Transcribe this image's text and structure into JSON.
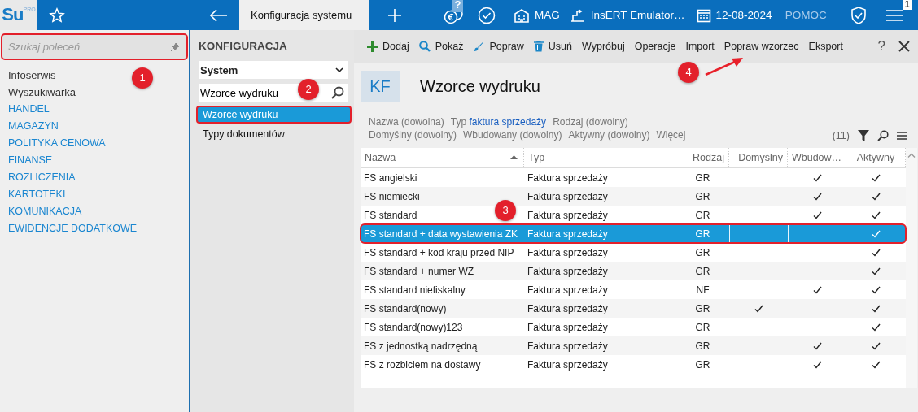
{
  "logo": {
    "text": "Su",
    "edition": "PRO"
  },
  "tabs": [
    {
      "label": "Konfiguracja systemu",
      "selected": true
    }
  ],
  "header_items": [
    {
      "kind": "coins",
      "badge": "?"
    },
    {
      "kind": "check"
    },
    {
      "kind": "building",
      "label": "MAG"
    },
    {
      "kind": "emulator",
      "label": "InsERT Emulator…"
    },
    {
      "kind": "calendar",
      "label": "12-08-2024"
    },
    {
      "kind": "text",
      "label": "POMOC"
    },
    {
      "kind": "shield"
    },
    {
      "kind": "menu",
      "badge": "1"
    }
  ],
  "sidebar": {
    "search": {
      "placeholder": "Szukaj poleceń",
      "highlighted": true
    },
    "items": [
      {
        "label": "Infoserwis",
        "kind": "link"
      },
      {
        "label": "Wyszukiwarka",
        "kind": "link"
      },
      {
        "label": "HANDEL",
        "kind": "module"
      },
      {
        "label": "MAGAZYN",
        "kind": "module"
      },
      {
        "label": "POLITYKA CENOWA",
        "kind": "module"
      },
      {
        "label": "FINANSE",
        "kind": "module"
      },
      {
        "label": "ROZLICZENIA",
        "kind": "module"
      },
      {
        "label": "KARTOTEKI",
        "kind": "module"
      },
      {
        "label": "KOMUNIKACJA",
        "kind": "module"
      },
      {
        "label": "EWIDENCJE DODATKOWE",
        "kind": "module"
      }
    ]
  },
  "config_panel": {
    "title": "KONFIGURACJA",
    "dropdown": "System",
    "search": {
      "value": "Wzorce wydruku"
    },
    "items": [
      {
        "label": "Wzorce wydruku",
        "selected": true,
        "highlighted": true
      },
      {
        "label": "Typy dokumentów",
        "selected": false,
        "highlighted": false
      }
    ]
  },
  "toolbar": {
    "buttons": [
      {
        "kind": "add",
        "label": "Dodaj"
      },
      {
        "kind": "show",
        "label": "Pokaż"
      },
      {
        "kind": "edit",
        "label": "Popraw"
      },
      {
        "kind": "delete",
        "label": "Usuń"
      },
      {
        "kind": "text",
        "label": "Wypróbuj"
      },
      {
        "kind": "text",
        "label": "Operacje"
      },
      {
        "kind": "text",
        "label": "Import"
      },
      {
        "kind": "text",
        "label": "Popraw wzorzec"
      },
      {
        "kind": "text",
        "label": "Eksport"
      }
    ],
    "help": "?"
  },
  "view": {
    "badge": "KF",
    "title": "Wzorce wydruku"
  },
  "filters": [
    [
      {
        "label": "Nazwa (dowolna)"
      },
      {
        "label": "Typ",
        "value": "faktura sprzedaży"
      },
      {
        "label": "Rodzaj (dowolny)"
      }
    ],
    [
      {
        "label": "Domyślny (dowolny)"
      },
      {
        "label": "Wbudowany (dowolny)"
      },
      {
        "label": "Aktywny (dowolny)"
      },
      {
        "label": "Więcej"
      }
    ]
  ],
  "count": "(11)",
  "table": {
    "columns": [
      {
        "label": "Nazwa",
        "sorted_ascending": true
      },
      {
        "label": "Typ",
        "sorted_ascending": false
      },
      {
        "label": "Rodzaj",
        "sorted_ascending": false
      },
      {
        "label": "Domyślny",
        "sorted_ascending": false
      },
      {
        "label": "Wbudow…",
        "sorted_ascending": false
      },
      {
        "label": "Aktywny",
        "sorted_ascending": false
      }
    ],
    "rows": [
      {
        "name": "FS angielski",
        "type": "Faktura sprzedaży",
        "kind": "GR",
        "default": false,
        "builtin": true,
        "active": true,
        "selected": false,
        "highlighted": false
      },
      {
        "name": "FS niemiecki",
        "type": "Faktura sprzedaży",
        "kind": "GR",
        "default": false,
        "builtin": true,
        "active": true,
        "selected": false,
        "highlighted": false
      },
      {
        "name": "FS standard",
        "type": "Faktura sprzedaży",
        "kind": "GR",
        "default": false,
        "builtin": true,
        "active": true,
        "selected": false,
        "highlighted": false
      },
      {
        "name": "FS standard + data wystawienia ZK",
        "type": "Faktura sprzedaży",
        "kind": "GR",
        "default": false,
        "builtin": false,
        "active": true,
        "selected": true,
        "highlighted": true
      },
      {
        "name": "FS standard + kod kraju przed NIP",
        "type": "Faktura sprzedaży",
        "kind": "GR",
        "default": false,
        "builtin": false,
        "active": true,
        "selected": false,
        "highlighted": false
      },
      {
        "name": "FS standard + numer WZ",
        "type": "Faktura sprzedaży",
        "kind": "GR",
        "default": false,
        "builtin": false,
        "active": true,
        "selected": false,
        "highlighted": false
      },
      {
        "name": "FS standard niefiskalny",
        "type": "Faktura sprzedaży",
        "kind": "NF",
        "default": false,
        "builtin": true,
        "active": true,
        "selected": false,
        "highlighted": false
      },
      {
        "name": "FS standard(nowy)",
        "type": "Faktura sprzedaży",
        "kind": "GR",
        "default": true,
        "builtin": false,
        "active": true,
        "selected": false,
        "highlighted": false
      },
      {
        "name": "FS standard(nowy)123",
        "type": "Faktura sprzedaży",
        "kind": "GR",
        "default": false,
        "builtin": false,
        "active": true,
        "selected": false,
        "highlighted": false
      },
      {
        "name": "FS z jednostką nadrzędną",
        "type": "Faktura sprzedaży",
        "kind": "GR",
        "default": false,
        "builtin": true,
        "active": true,
        "selected": false,
        "highlighted": false
      },
      {
        "name": "FS z rozbiciem na dostawy",
        "type": "Faktura sprzedaży",
        "kind": "GR",
        "default": false,
        "builtin": true,
        "active": true,
        "selected": false,
        "highlighted": false
      }
    ]
  },
  "annotations": [
    {
      "number": "1",
      "kind": "marker"
    },
    {
      "number": "2",
      "kind": "marker"
    },
    {
      "number": "3",
      "kind": "marker"
    },
    {
      "number": "4",
      "kind": "marker_with_arrow"
    }
  ]
}
